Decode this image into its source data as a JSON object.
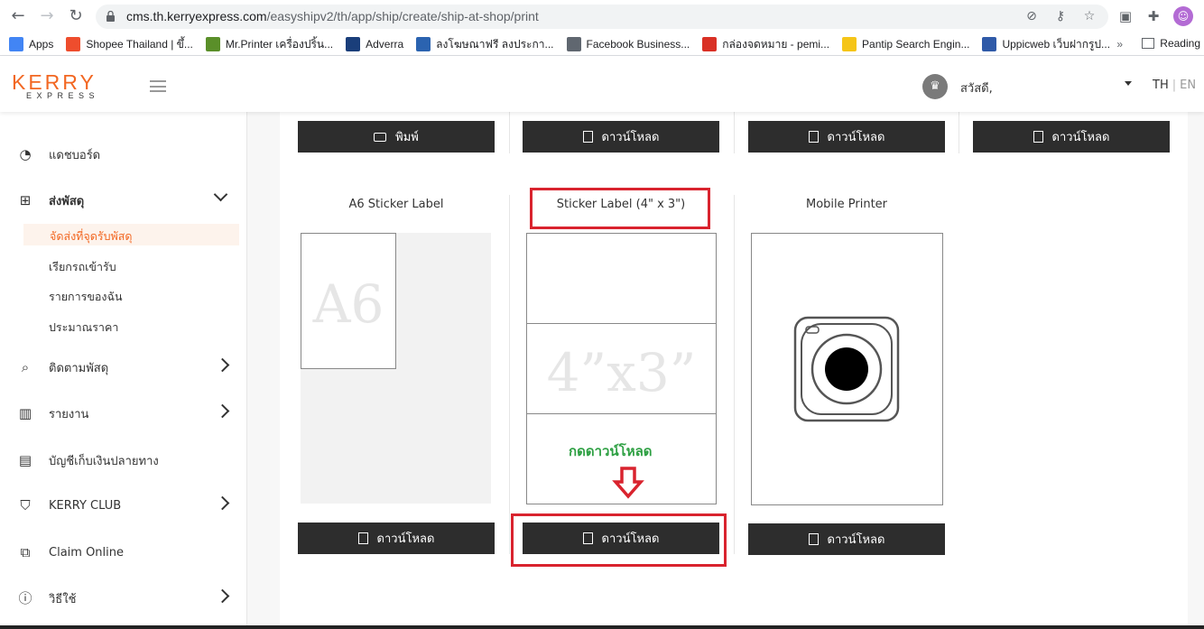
{
  "browser": {
    "url_host": "cms.th.kerryexpress.com",
    "url_path": "/easyshipv2/th/app/ship/create/ship-at-shop/print",
    "bookmarks": [
      {
        "label": "Apps",
        "color": "#4285f4"
      },
      {
        "label": "Shopee Thailand | ขึ้...",
        "color": "#ee4d2d"
      },
      {
        "label": "Mr.Printer เครื่องปริ้น...",
        "color": "#5a8f29"
      },
      {
        "label": "Adverra",
        "color": "#1a3e7a"
      },
      {
        "label": "ลงโฆษณาฟรี ลงประกา...",
        "color": "#2b63b0"
      },
      {
        "label": "Facebook Business...",
        "color": "#606770"
      },
      {
        "label": "กล่องจดหมาย - pemi...",
        "color": "#d93025"
      },
      {
        "label": "Pantip Search Engin...",
        "color": "#f5c518"
      },
      {
        "label": "Uppicweb เว็บฝากรูป...",
        "color": "#2f5aa8"
      }
    ],
    "more": "»",
    "reading": "Reading"
  },
  "header": {
    "logo_top": "KERRY",
    "logo_bottom": "EXPRESS",
    "greeting": "สวัสดี,",
    "lang_th": "TH",
    "lang_sep": "|",
    "lang_en": "EN"
  },
  "sidebar": {
    "dashboard": "แดชบอร์ด",
    "ship": "ส่งพัสดุ",
    "ship_sub": [
      "จัดส่งที่จุดรับพัสดุ",
      "เรียกรถเข้ารับ",
      "รายการของฉัน",
      "ประมาณราคา"
    ],
    "track": "ติดตามพัสดุ",
    "report": "รายงาน",
    "cod": "บัญชีเก็บเงินปลายทาง",
    "club": "KERRY CLUB",
    "claim": "Claim Online",
    "howto": "วิธีใช้"
  },
  "top_buttons": [
    "พิมพ์",
    "ดาวน์โหลด",
    "ดาวน์โหลด",
    "ดาวน์โหลด"
  ],
  "cards": [
    {
      "title": "A6 Sticker Label",
      "watermark": "A6",
      "button": "ดาวน์โหลด"
    },
    {
      "title": "Sticker Label (4\" x 3\")",
      "watermark": "4”x3”",
      "button": "ดาวน์โหลด"
    },
    {
      "title": "Mobile Printer",
      "button": "ดาวน์โหลด"
    }
  ],
  "annotation": {
    "note": "กดดาวน์โหลด",
    "color": "#d9232e"
  },
  "colors": {
    "brand": "#f26722",
    "button_dark": "#2d2d2d"
  }
}
